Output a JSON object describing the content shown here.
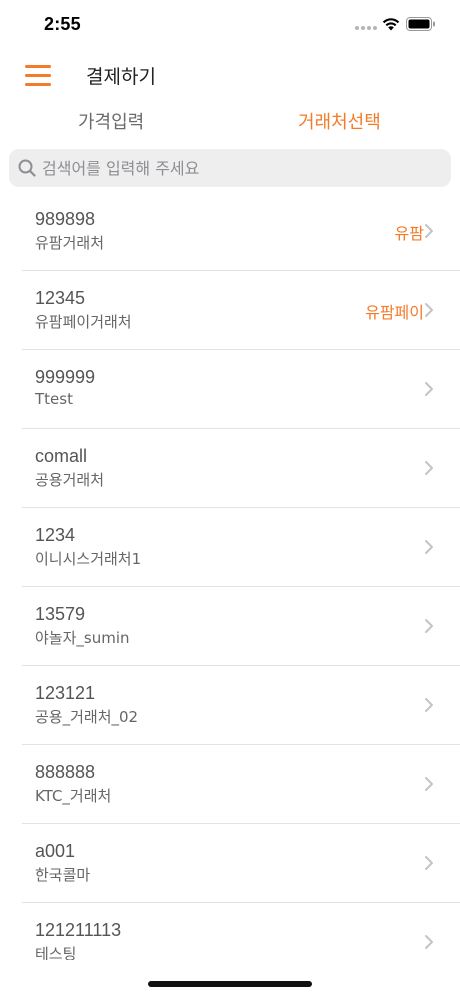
{
  "status_bar": {
    "time": "2:55"
  },
  "nav": {
    "title": "결제하기"
  },
  "tabs": [
    {
      "label": "가격입력",
      "active": false
    },
    {
      "label": "거래처선택",
      "active": true
    }
  ],
  "search": {
    "placeholder": "검색어를 입력해 주세요",
    "value": ""
  },
  "clients": [
    {
      "code": "989898",
      "name": "유팜거래처",
      "tag": "유팜"
    },
    {
      "code": "12345",
      "name": "유팜페이거래처",
      "tag": "유팜페이"
    },
    {
      "code": "999999",
      "name": "Ttest",
      "tag": ""
    },
    {
      "code": "comall",
      "name": "공용거래처",
      "tag": ""
    },
    {
      "code": "1234",
      "name": "이니시스거래처1",
      "tag": ""
    },
    {
      "code": "13579",
      "name": "야놀자_sumin",
      "tag": ""
    },
    {
      "code": "123121",
      "name": "공용_거래처_02",
      "tag": ""
    },
    {
      "code": "888888",
      "name": "KTC_거래처",
      "tag": ""
    },
    {
      "code": "a001",
      "name": "한국콜마",
      "tag": ""
    },
    {
      "code": "121211113",
      "name": "테스팅",
      "tag": ""
    }
  ],
  "colors": {
    "accent": "#f47b2a",
    "text": "#555555",
    "separator": "#e3e3e3",
    "search_bg": "#eeeeef"
  }
}
